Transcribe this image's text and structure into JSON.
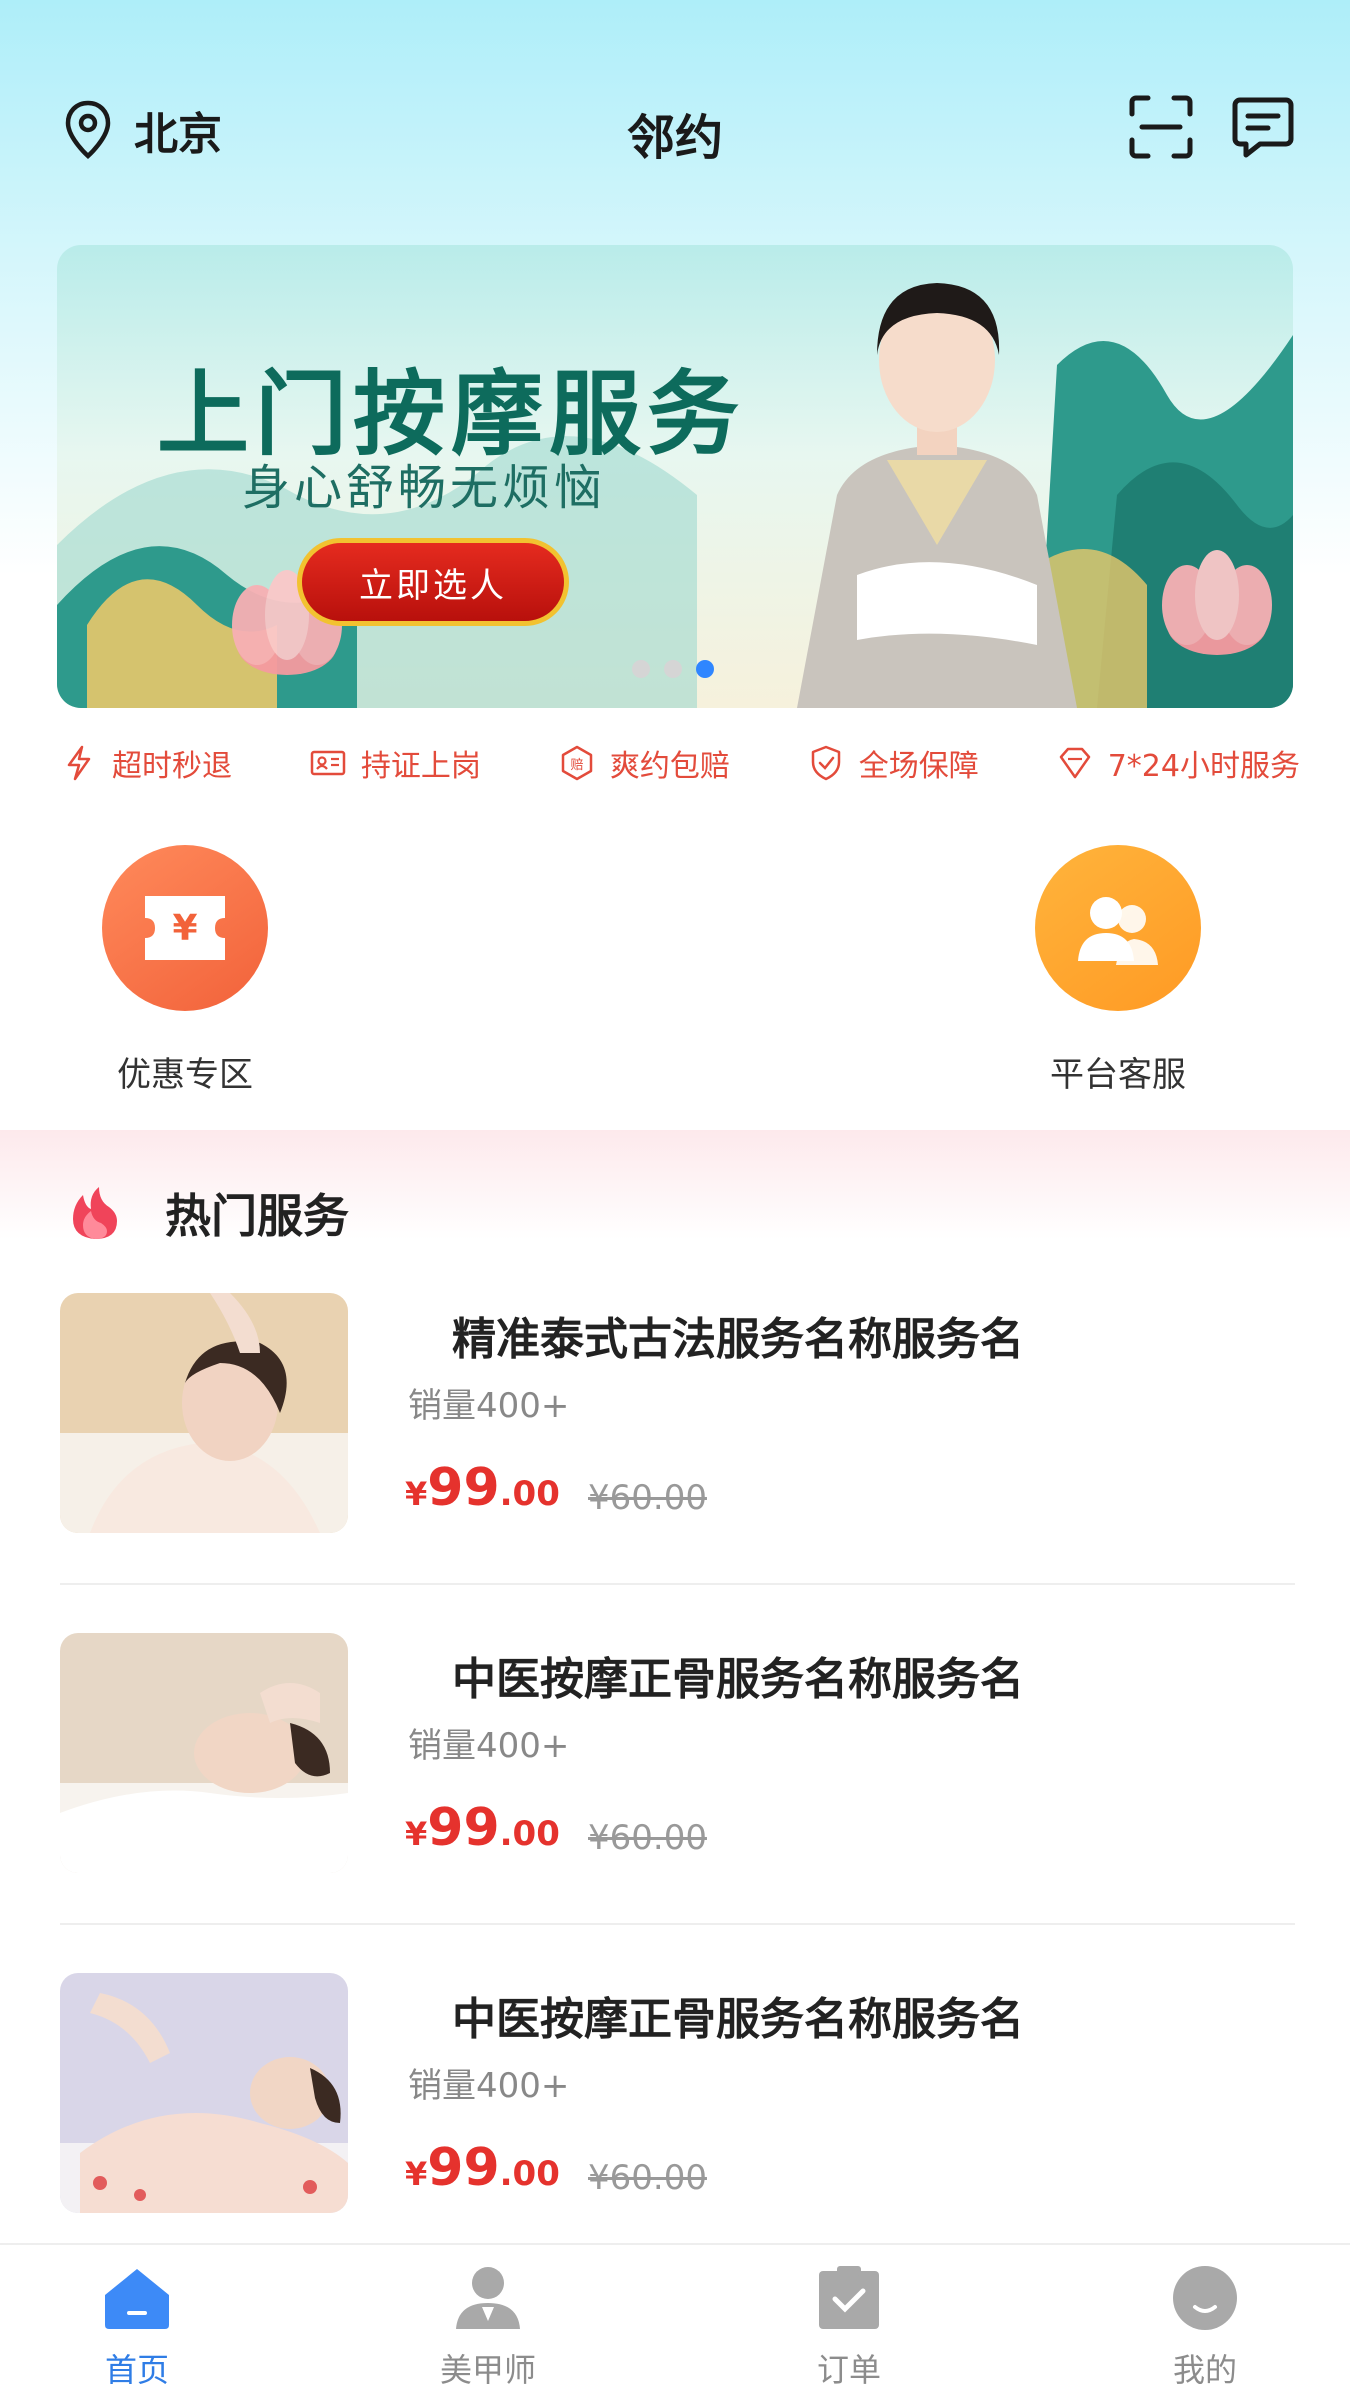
{
  "header": {
    "location": "北京",
    "title": "邻约"
  },
  "banner": {
    "title": "上门按摩服务",
    "subtitle": "身心舒畅无烦恼",
    "button_label": "立即选人",
    "slides": 3,
    "active_slide": 3
  },
  "features": [
    {
      "icon": "lightning-icon",
      "label": "超时秒退"
    },
    {
      "icon": "id-card-icon",
      "label": "持证上岗"
    },
    {
      "icon": "compensation-icon",
      "label": "爽约包赔"
    },
    {
      "icon": "shield-check-icon",
      "label": "全场保障"
    },
    {
      "icon": "diamond-icon",
      "label": "7*24小时服务"
    }
  ],
  "quick_actions": [
    {
      "icon": "coupon-icon",
      "label": "优惠专区"
    },
    {
      "icon": "customer-service-icon",
      "label": "平台客服"
    }
  ],
  "hot": {
    "title": "热门服务",
    "items": [
      {
        "name": "精准泰式古法服务名称服务名",
        "sales": "销量400+",
        "price_symbol": "¥",
        "price_int": "99",
        "price_dec": ".00",
        "original_price": "¥60.00"
      },
      {
        "name": "中医按摩正骨服务名称服务名",
        "sales": "销量400+",
        "price_symbol": "¥",
        "price_int": "99",
        "price_dec": ".00",
        "original_price": "¥60.00"
      },
      {
        "name": "中医按摩正骨服务名称服务名",
        "sales": "销量400+",
        "price_symbol": "¥",
        "price_int": "99",
        "price_dec": ".00",
        "original_price": "¥60.00"
      }
    ]
  },
  "tabbar": {
    "items": [
      {
        "label": "首页",
        "icon": "home-icon",
        "active": true
      },
      {
        "label": "美甲师",
        "icon": "person-icon",
        "active": false
      },
      {
        "label": "订单",
        "icon": "order-icon",
        "active": false
      },
      {
        "label": "我的",
        "icon": "profile-icon",
        "active": false
      }
    ]
  },
  "colors": {
    "accent_red": "#e5322d",
    "tab_active": "#2f7de6",
    "feature_red": "#e34b3b"
  }
}
